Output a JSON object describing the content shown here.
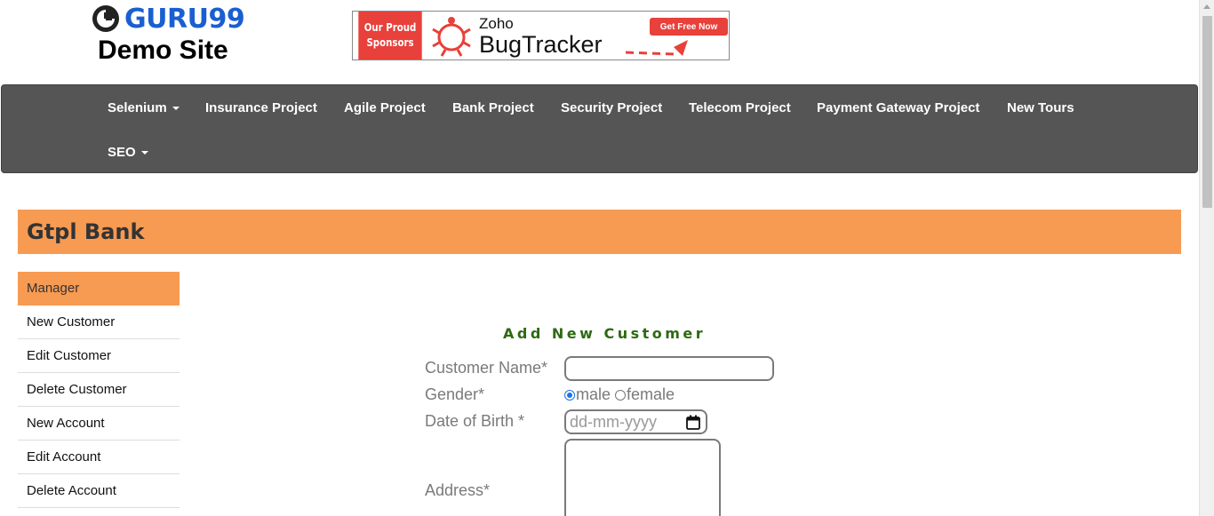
{
  "header": {
    "logo_text": "GURU99",
    "logo_subtitle": "Demo Site"
  },
  "banner": {
    "sponsor_line1": "Our Proud",
    "sponsor_line2": "Sponsors",
    "brand_small": "Zoho",
    "brand_big": "BugTracker",
    "cta": "Get Free Now"
  },
  "nav": {
    "items": [
      {
        "label": "Selenium",
        "dropdown": true
      },
      {
        "label": "Insurance Project",
        "dropdown": false
      },
      {
        "label": "Agile Project",
        "dropdown": false
      },
      {
        "label": "Bank Project",
        "dropdown": false
      },
      {
        "label": "Security Project",
        "dropdown": false
      },
      {
        "label": "Telecom Project",
        "dropdown": false
      },
      {
        "label": "Payment Gateway Project",
        "dropdown": false
      },
      {
        "label": "New Tours",
        "dropdown": false
      },
      {
        "label": "SEO",
        "dropdown": true
      }
    ]
  },
  "bank": {
    "title": "Gtpl Bank"
  },
  "sidebar": {
    "items": [
      {
        "label": "Manager",
        "active": true
      },
      {
        "label": "New Customer",
        "active": false
      },
      {
        "label": "Edit Customer",
        "active": false
      },
      {
        "label": "Delete Customer",
        "active": false
      },
      {
        "label": "New Account",
        "active": false
      },
      {
        "label": "Edit Account",
        "active": false
      },
      {
        "label": "Delete Account",
        "active": false
      }
    ]
  },
  "form": {
    "heading": "Add New Customer",
    "customer_name_label": "Customer Name*",
    "customer_name_value": "",
    "gender_label": "Gender*",
    "gender_options": [
      "male",
      "female"
    ],
    "gender_selected": "male",
    "dob_label": "Date of Birth *",
    "dob_placeholder": "dd-mm-yyyy",
    "address_label": "Address*",
    "address_value": ""
  },
  "colors": {
    "accent_orange": "#f79a52",
    "navbar_bg": "#555555",
    "heading_green": "#2d6a12",
    "logo_blue": "#1a5fd1"
  },
  "icons": [
    "guru99-logo-icon",
    "bug-icon",
    "caret-down-icon",
    "calendar-icon",
    "dashed-arrow-icon"
  ]
}
